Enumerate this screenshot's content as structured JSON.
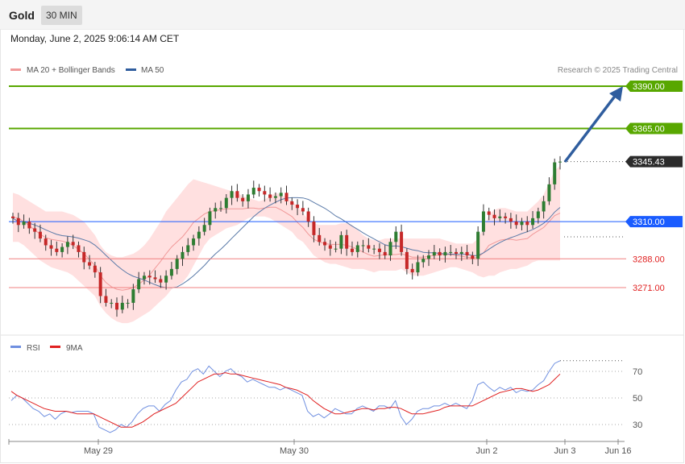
{
  "header": {
    "symbol": "Gold",
    "timeframe": "30 MIN",
    "datetime": "Monday, June 2, 2025 9:06:14 AM CET"
  },
  "legend": {
    "ma20": "MA 20 + Bollinger Bands",
    "ma50": "MA 50",
    "copyright": "Research © 2025 Trading Central"
  },
  "rsi_legend": {
    "rsi": "RSI",
    "ma9": "9MA"
  },
  "x_ticks": [
    "May 29",
    "May 30",
    "Jun 2",
    "Jun 3",
    "Jun 16"
  ],
  "colors": {
    "resistance": "#58a700",
    "pivot": "#1a5cff",
    "support": "#e84a4a",
    "arrow": "#2f5d9e",
    "bands": "#ffe0e0",
    "ma20": "#f19999",
    "ma50": "#5a7aa8",
    "up": "#2e7d32",
    "down": "#c62828",
    "rsi": "#6f8fe0",
    "ma9": "#e02020"
  },
  "chart_data": [
    {
      "type": "candlestick",
      "title": "Gold",
      "timeframe": "30 MIN",
      "ylim": [
        3245,
        3400
      ],
      "levels": [
        {
          "label": "3390.00",
          "value": 3390.0,
          "kind": "resistance"
        },
        {
          "label": "3365.00",
          "value": 3365.0,
          "kind": "resistance"
        },
        {
          "label": "3345.43",
          "value": 3345.43,
          "kind": "last"
        },
        {
          "label": "3310.00",
          "value": 3310.0,
          "kind": "pivot"
        },
        {
          "label": "3288.00",
          "value": 3288.0,
          "kind": "support"
        },
        {
          "label": "3271.00",
          "value": 3271.0,
          "kind": "support"
        }
      ],
      "series_close": [
        3312,
        3308,
        3310,
        3306,
        3304,
        3300,
        3296,
        3294,
        3292,
        3295,
        3298,
        3296,
        3292,
        3286,
        3284,
        3280,
        3266,
        3262,
        3262,
        3258,
        3262,
        3262,
        3270,
        3276,
        3278,
        3277,
        3276,
        3274,
        3278,
        3282,
        3288,
        3292,
        3296,
        3300,
        3304,
        3308,
        3316,
        3318,
        3318,
        3324,
        3328,
        3324,
        3322,
        3326,
        3330,
        3328,
        3326,
        3324,
        3325,
        3327,
        3322,
        3320,
        3318,
        3316,
        3310,
        3302,
        3298,
        3296,
        3294,
        3294,
        3302,
        3294,
        3292,
        3296,
        3296,
        3294,
        3294,
        3292,
        3290,
        3298,
        3304,
        3292,
        3282,
        3280,
        3286,
        3288,
        3290,
        3292,
        3290,
        3292,
        3292,
        3291,
        3292,
        3290,
        3288,
        3304,
        3316,
        3314,
        3312,
        3313,
        3312,
        3310,
        3308,
        3310,
        3308,
        3312,
        3316,
        3322,
        3332,
        3345,
        3345.43
      ],
      "bollinger_upper": [
        3327,
        3326,
        3324,
        3322,
        3320,
        3318,
        3316,
        3316,
        3316,
        3316,
        3315,
        3314,
        3312,
        3310,
        3306,
        3302,
        3296,
        3292,
        3290,
        3289,
        3289,
        3290,
        3291,
        3293,
        3296,
        3300,
        3305,
        3310,
        3316,
        3320,
        3324,
        3328,
        3332,
        3335,
        3334,
        3333,
        3332,
        3331,
        3330,
        3329,
        3328,
        3327,
        3325,
        3324,
        3323,
        3322,
        3323,
        3325,
        3327,
        3326,
        3324,
        3322,
        3319,
        3315,
        3311,
        3309,
        3308,
        3308,
        3308,
        3308,
        3309,
        3309,
        3308,
        3305,
        3302,
        3300,
        3299,
        3299,
        3300,
        3300,
        3300,
        3300,
        3300,
        3300,
        3300,
        3300,
        3300,
        3300,
        3300,
        3299,
        3298,
        3297,
        3297,
        3297,
        3297,
        3300,
        3306,
        3314,
        3317,
        3318,
        3318,
        3317,
        3316,
        3316,
        3316,
        3319,
        3322,
        3326,
        3333,
        3340,
        3343
      ],
      "bollinger_lower": [
        3298,
        3298,
        3296,
        3293,
        3290,
        3287,
        3285,
        3283,
        3282,
        3281,
        3280,
        3278,
        3275,
        3272,
        3269,
        3266,
        3260,
        3256,
        3253,
        3251,
        3250,
        3250,
        3251,
        3253,
        3255,
        3257,
        3260,
        3263,
        3266,
        3270,
        3272,
        3274,
        3278,
        3284,
        3290,
        3296,
        3300,
        3302,
        3304,
        3306,
        3307,
        3308,
        3310,
        3312,
        3313,
        3313,
        3313,
        3312,
        3310,
        3308,
        3306,
        3304,
        3300,
        3298,
        3294,
        3290,
        3288,
        3286,
        3285,
        3285,
        3284,
        3283,
        3282,
        3282,
        3282,
        3281,
        3280,
        3281,
        3281,
        3281,
        3281,
        3282,
        3280,
        3278,
        3278,
        3278,
        3279,
        3280,
        3281,
        3282,
        3283,
        3283,
        3282,
        3281,
        3280,
        3278,
        3277,
        3278,
        3278,
        3280,
        3281,
        3282,
        3282,
        3283,
        3284,
        3286,
        3287,
        3287,
        3287,
        3287,
        3287
      ]
    },
    {
      "type": "line",
      "title": "RSI",
      "ylim": [
        20,
        85
      ],
      "y_ticks": [
        70,
        50,
        30
      ],
      "series": [
        {
          "name": "RSI",
          "values": [
            48,
            52,
            50,
            46,
            42,
            40,
            36,
            38,
            34,
            38,
            40,
            39,
            40,
            40,
            40,
            38,
            28,
            26,
            24,
            26,
            30,
            28,
            32,
            38,
            42,
            44,
            44,
            40,
            45,
            48,
            56,
            62,
            64,
            70,
            72,
            68,
            74,
            70,
            66,
            70,
            72,
            68,
            66,
            62,
            64,
            62,
            60,
            58,
            58,
            56,
            58,
            56,
            54,
            52,
            40,
            36,
            38,
            35,
            38,
            42,
            40,
            38,
            38,
            42,
            44,
            42,
            40,
            44,
            44,
            42,
            48,
            36,
            30,
            34,
            40,
            42,
            42,
            44,
            44,
            46,
            44,
            46,
            44,
            42,
            48,
            60,
            62,
            58,
            55,
            58,
            56,
            58,
            54,
            56,
            55,
            56,
            60,
            63,
            70,
            76,
            78
          ]
        },
        {
          "name": "9MA",
          "values": [
            55,
            52,
            50,
            48,
            46,
            44,
            42,
            41,
            40,
            40,
            40,
            39,
            38,
            38,
            38,
            38,
            36,
            34,
            32,
            30,
            28,
            28,
            28,
            30,
            32,
            35,
            38,
            40,
            42,
            44,
            46,
            50,
            54,
            58,
            62,
            64,
            66,
            68,
            68,
            69,
            68,
            68,
            67,
            66,
            65,
            64,
            63,
            62,
            61,
            60,
            58,
            57,
            56,
            54,
            52,
            48,
            45,
            42,
            40,
            38,
            38,
            39,
            40,
            41,
            42,
            42,
            41,
            42,
            42,
            43,
            43,
            42,
            40,
            38,
            38,
            38,
            39,
            40,
            41,
            43,
            44,
            44,
            44,
            44,
            44,
            46,
            48,
            50,
            52,
            54,
            55,
            56,
            57,
            57,
            56,
            55,
            56,
            58,
            60,
            64,
            68
          ]
        }
      ]
    }
  ]
}
